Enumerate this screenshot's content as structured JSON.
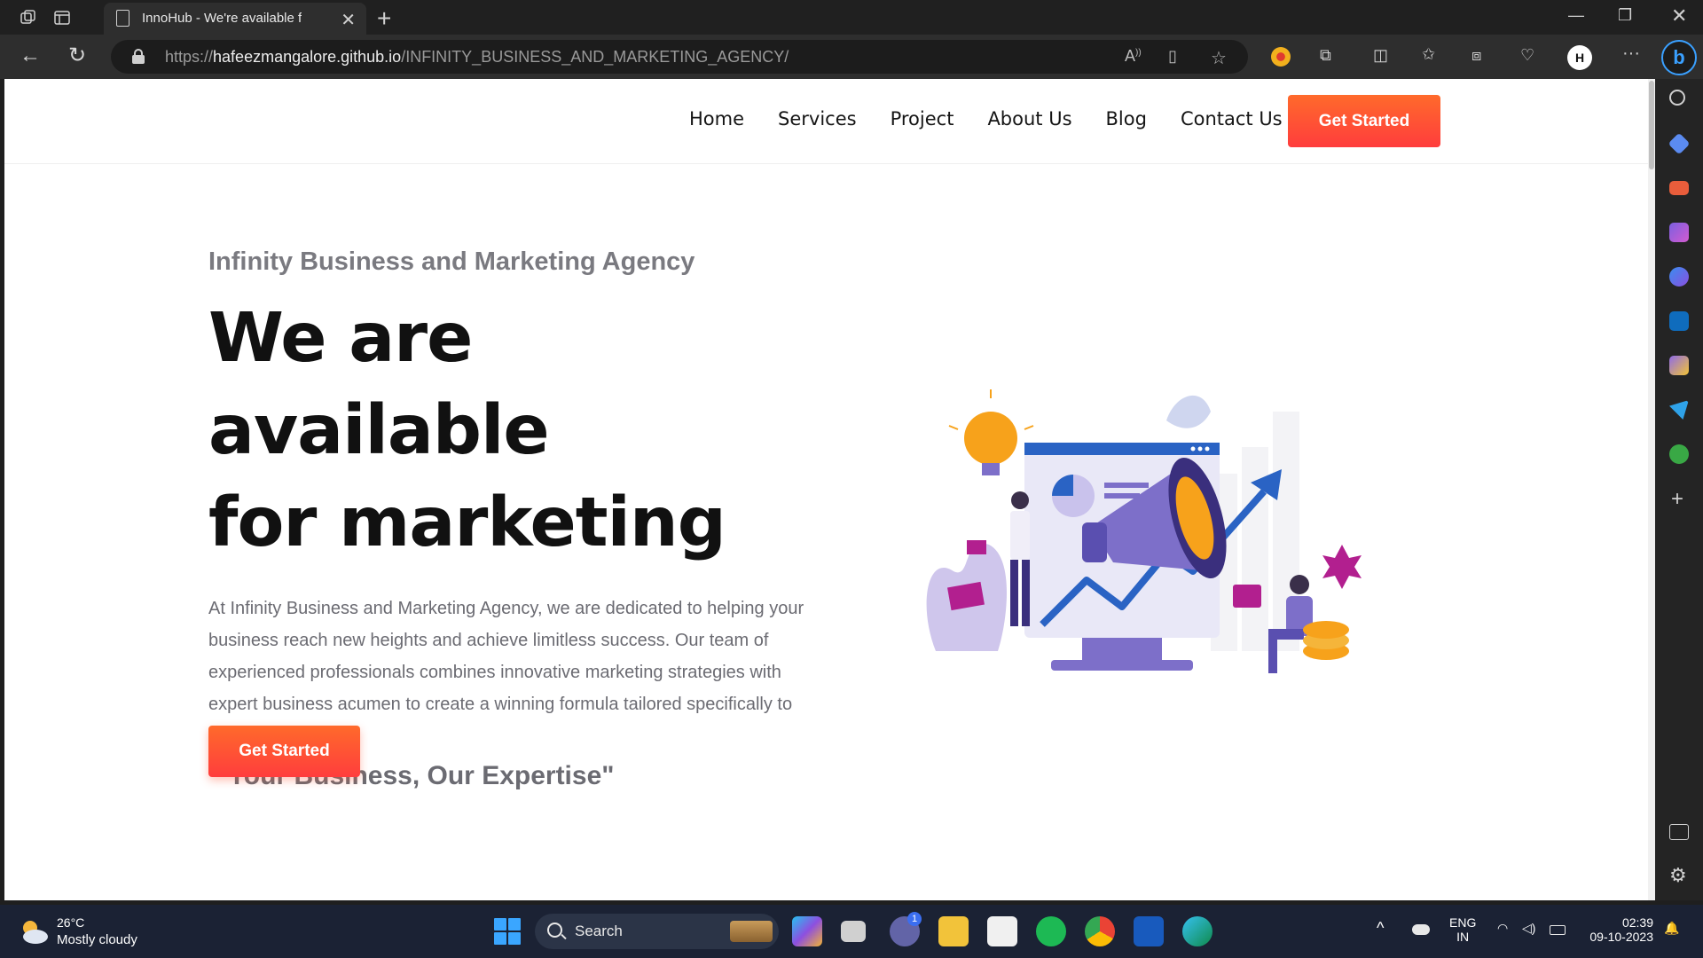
{
  "browser": {
    "tab_title": "InnoHub - We're available for marketing",
    "url_scheme": "https://",
    "url_host": "hafeezmangalore.github.io",
    "url_path": "/INFINITY_BUSINESS_AND_MARKETING_AGENCY/"
  },
  "site": {
    "nav": [
      "Home",
      "Services",
      "Project",
      "About Us",
      "Blog",
      "Contact Us"
    ],
    "header_cta": "Get Started",
    "hero": {
      "eyebrow": "Infinity Business and Marketing Agency",
      "headline_line1": "We are available",
      "headline_line2": "for marketing",
      "description": "At Infinity Business and Marketing Agency, we are dedicated to helping your business reach new heights and achieve limitless success. Our team of experienced professionals combines innovative marketing strategies with expert business acumen to create a winning formula tailored specifically to your unique needs.",
      "tagline": "\" Your Business, Our Expertise\"",
      "cta": "Get Started"
    }
  },
  "taskbar": {
    "weather_temp": "26°C",
    "weather_desc": "Mostly cloudy",
    "search_label": "Search",
    "chat_badge": "1",
    "lang_top": "ENG",
    "lang_bottom": "IN",
    "time": "02:39",
    "date": "09-10-2023"
  },
  "colors": {
    "accent_start": "#ff6a2b",
    "accent_end": "#ff3d3d",
    "illustration_purple": "#7d6fc9",
    "illustration_blue": "#2a63c4",
    "illustration_orange": "#f7a21b"
  }
}
